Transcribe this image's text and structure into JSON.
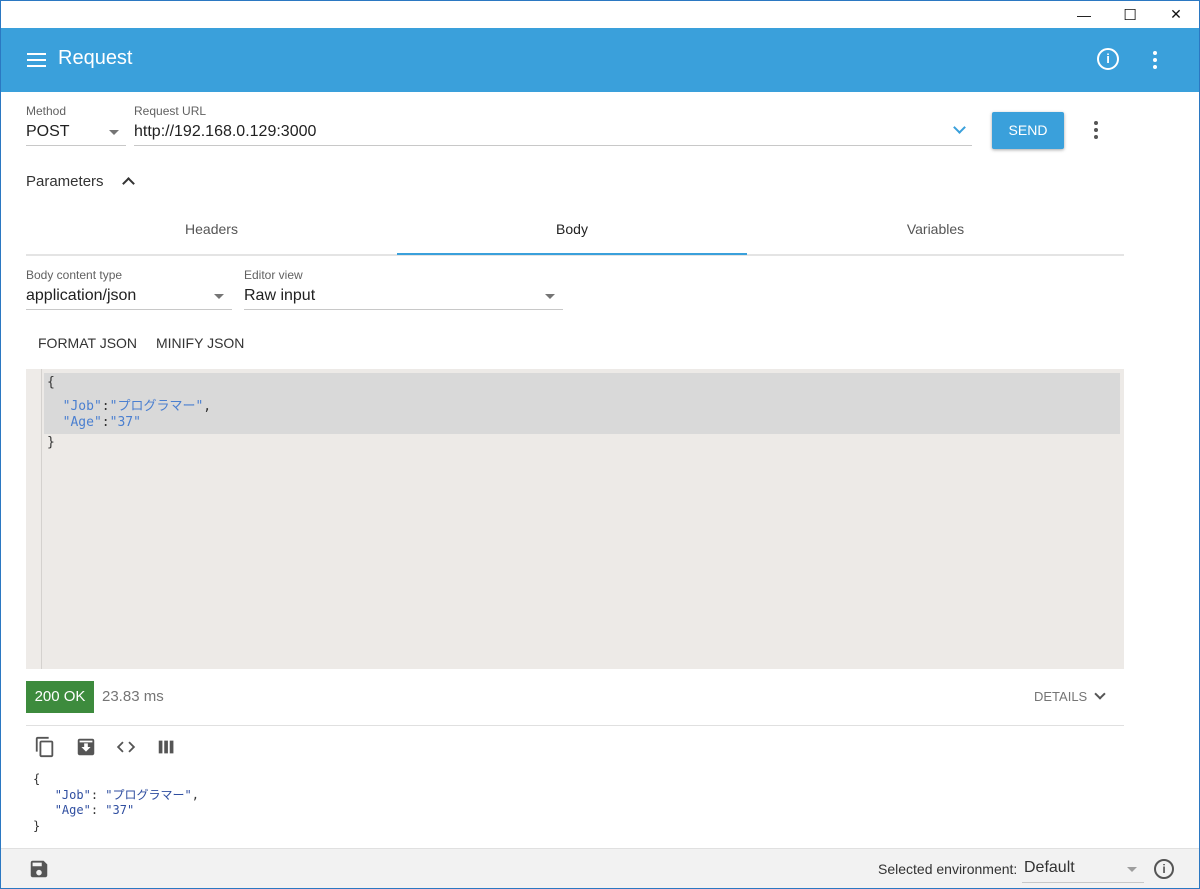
{
  "window": {
    "minimize_glyph": "—",
    "maximize_glyph": "☐",
    "close_glyph": "✕"
  },
  "appbar": {
    "title": "Request",
    "info_glyph": "i"
  },
  "request": {
    "method_label": "Method",
    "method_value": "POST",
    "url_label": "Request URL",
    "url_value": "http://192.168.0.129:3000",
    "send_label": "SEND"
  },
  "parameters": {
    "label": "Parameters"
  },
  "tabs": [
    {
      "label": "Headers"
    },
    {
      "label": "Body"
    },
    {
      "label": "Variables"
    }
  ],
  "body": {
    "content_type_label": "Body content type",
    "content_type_value": "application/json",
    "editor_view_label": "Editor view",
    "editor_view_value": "Raw input",
    "format_label": "FORMAT JSON",
    "minify_label": "MINIFY JSON"
  },
  "editor": {
    "open_brace": "{",
    "job_key": "\"Job\"",
    "job_sep": ":",
    "job_value": "\"プログラマー\"",
    "job_trail": ",",
    "age_key": "\"Age\"",
    "age_sep": ":",
    "age_value": "\"37\"",
    "close_brace": "}"
  },
  "response": {
    "status": "200 OK",
    "time": "23.83 ms",
    "details_label": "DETAILS",
    "open_brace": "{",
    "job_key": "\"Job\"",
    "job_sep": ": ",
    "job_value": "\"プログラマー\"",
    "job_trail": ",",
    "age_key": "\"Age\"",
    "age_sep": ": ",
    "age_value": "\"37\"",
    "close_brace": "}"
  },
  "footer": {
    "env_label": "Selected environment:",
    "env_value": "Default",
    "info_glyph": "i"
  },
  "colors": {
    "accent": "#3aa0db",
    "success": "#3d8b3d"
  },
  "icons": [
    "menu-icon",
    "info-icon",
    "more-vert-icon",
    "chevron-down-icon",
    "chevron-up-icon",
    "copy-icon",
    "download-icon",
    "code-icon",
    "columns-icon",
    "save-icon"
  ]
}
